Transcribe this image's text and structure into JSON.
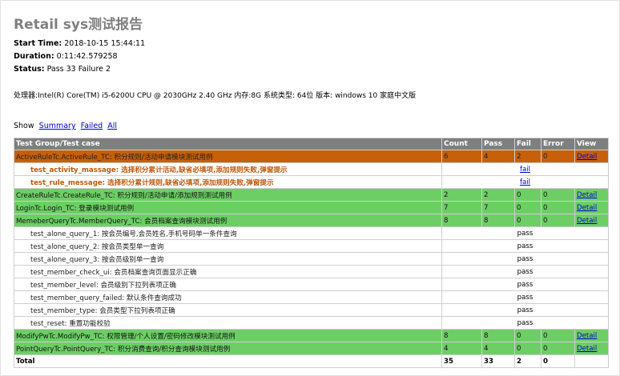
{
  "report": {
    "title": "Retail sys测试报告",
    "start_label": "Start Time:",
    "start_value": "2018-10-15 15:44:11",
    "duration_label": "Duration:",
    "duration_value": "0:11:42.579258",
    "status_label": "Status:",
    "status_value": "Pass 33 Failure 2",
    "system_info": "处理器:Intel(R) Core(TM) i5-6200U CPU @ 2030GHz 2.40 GHz 内存:8G 系统类型: 64位 版本: windows 10 家庭中文版"
  },
  "show": {
    "label": "Show",
    "summary": "Summary",
    "failed": "Failed",
    "all": "All"
  },
  "table": {
    "headers": [
      "Test Group/Test case",
      "Count",
      "Pass",
      "Fail",
      "Error",
      "View"
    ],
    "rows": [
      {
        "type": "fail",
        "name": "ActiveRuleTc.ActiveRule_TC: 积分规则/活动申请模块测试用例",
        "count": "6",
        "pass": "4",
        "fail": "2",
        "error": "0",
        "view": "Detail"
      },
      {
        "type": "failcase",
        "name": "test_activity_massage: 选择积分累计活动,缺省必填项,添加规则失败,弹窗提示",
        "status": "fail"
      },
      {
        "type": "failcase",
        "name": "test_rule_message: 选择积分累计规则,缺省必填项,添加规则失败,弹窗提示",
        "status": "fail"
      },
      {
        "type": "pass",
        "name": "CreateRuleTc.CreateRule_TC: 积分规则/活动申请/添加规则测试用例",
        "count": "2",
        "pass": "2",
        "fail": "0",
        "error": "0",
        "view": "Detail"
      },
      {
        "type": "pass",
        "name": "LoginTc.Login_TC: 登录模块测试用例",
        "count": "7",
        "pass": "7",
        "fail": "0",
        "error": "0",
        "view": "Detail"
      },
      {
        "type": "pass",
        "name": "MemeberQueryTc.MemberQuery_TC: 会员档案查询模块测试用例",
        "count": "8",
        "pass": "8",
        "fail": "0",
        "error": "0",
        "view": "Detail"
      },
      {
        "type": "test",
        "name": "test_alone_query_1: 按会员编号,会员姓名,手机号码单一条件查询",
        "status": "pass"
      },
      {
        "type": "test",
        "name": "test_alone_query_2: 按会员类型单一查询",
        "status": "pass"
      },
      {
        "type": "test",
        "name": "test_alone_query_3: 按会员级别单一查询",
        "status": "pass"
      },
      {
        "type": "test",
        "name": "test_member_check_ui: 会员档案查询页面显示正确",
        "status": "pass"
      },
      {
        "type": "test",
        "name": "test_member_level: 会员级别下拉列表项正确",
        "status": "pass"
      },
      {
        "type": "test",
        "name": "test_member_query_failed: 默认条件查询成功",
        "status": "pass"
      },
      {
        "type": "test",
        "name": "test_member_type: 会员类型下拉列表项正确",
        "status": "pass"
      },
      {
        "type": "test",
        "name": "test_reset: 重置功能校验",
        "status": "pass"
      },
      {
        "type": "pass",
        "name": "ModifyPwTc.ModifyPw_TC: 权限管理/个人设置/密码修改模块测试用例",
        "count": "8",
        "pass": "8",
        "fail": "0",
        "error": "0",
        "view": "Detail"
      },
      {
        "type": "pass",
        "name": "PointQueryTc.PointQuery_TC: 积分消费查询/积分查询模块测试用例",
        "count": "4",
        "pass": "4",
        "fail": "0",
        "error": "0",
        "view": "Detail"
      },
      {
        "type": "total",
        "name": "Total",
        "count": "35",
        "pass": "33",
        "fail": "2",
        "error": "0",
        "view": ""
      }
    ]
  },
  "colors": {
    "fail_group": "#c76008",
    "pass_group": "#6ccf64",
    "header": "#7f7f7f",
    "failcase_text": "#c0580a",
    "link": "#0000cc"
  }
}
